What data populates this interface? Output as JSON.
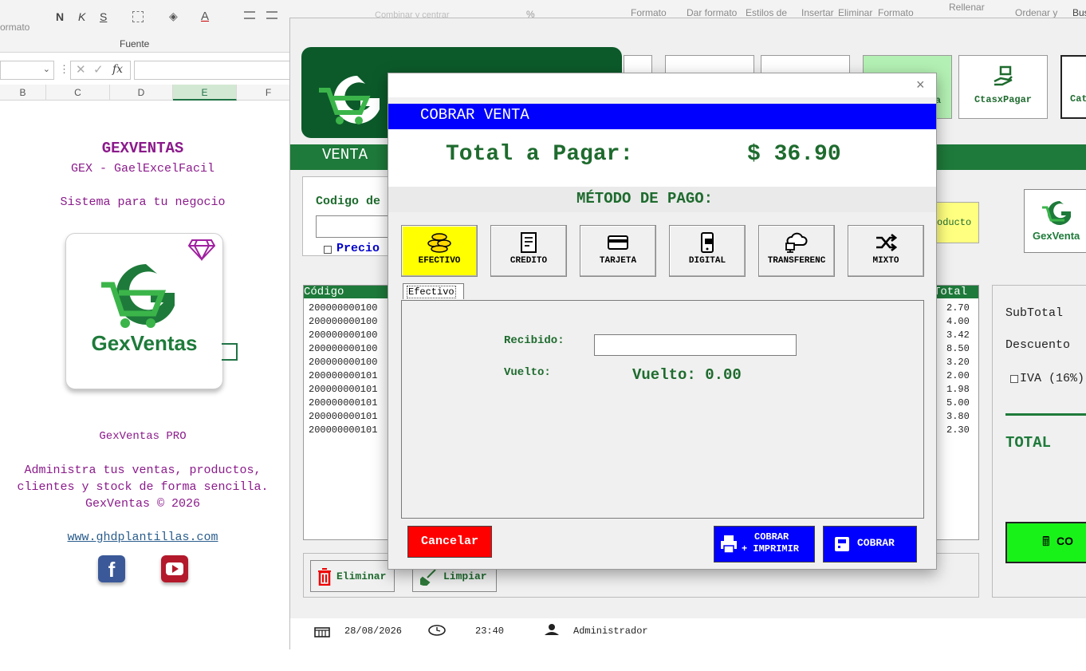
{
  "excel": {
    "ribbon": {
      "format_left": "ormato",
      "font_group": "Fuente",
      "bold": "N",
      "italic": "K",
      "underline": "S",
      "cmd_formato": "Formato",
      "cmd_dar_formato": "Dar formato",
      "cmd_estilos": "Estilos de",
      "cmd_insertar": "Insertar",
      "cmd_eliminar": "Eliminar",
      "cmd_formato2": "Formato",
      "cmd_rellenar": "Rellenar",
      "cmd_ordenar": "Ordenar y",
      "cmd_buscar": "Bus",
      "cmd_combinar": "Combinar y centrar",
      "percent": "%"
    },
    "formula_fx": "fx",
    "columns": [
      "B",
      "C",
      "D",
      "E",
      "F"
    ],
    "selected_column": "E",
    "sheet": {
      "title": "GEXVENTAS",
      "subtitle": "GEX - GaelExcelFacil",
      "tagline": "Sistema para tu negocio",
      "logo_text": "GexVentas",
      "pro_label": "GexVentas PRO",
      "desc1": "Administra tus ventas, productos,",
      "desc2": "clientes y stock de forma sencilla.",
      "copyright": "GexVentas © 2026",
      "website": "www.ghdplantillas.com"
    }
  },
  "app": {
    "toolbar": {
      "ctasxpagar": "CtasxPagar",
      "cat": "Cat",
      "partial_a": "a"
    },
    "venta_label": "VENTA",
    "codigo_label": "Codigo de",
    "precio_label": "Precio",
    "producto_btn": "oducto",
    "logo_small": "GexVenta",
    "table": {
      "header_codigo": "Código",
      "header_total": "Total",
      "codes": [
        "200000000100",
        "200000000100",
        "200000000100",
        "200000000100",
        "200000000100",
        "200000000101",
        "200000000101",
        "200000000101",
        "200000000101",
        "200000000101"
      ],
      "totals": [
        "2.70",
        "4.00",
        "3.42",
        "8.50",
        "3.20",
        "2.00",
        "1.98",
        "5.00",
        "3.80",
        "2.30"
      ]
    },
    "summary": {
      "subtotal": "SubTotal",
      "descuento": "Descuento",
      "iva": "IVA (16%)",
      "total": "TOTAL",
      "cobrar_partial": "CO"
    },
    "bottom": {
      "eliminar": "Eliminar",
      "limpiar": "Limpiar"
    },
    "status": {
      "date": "28/08/2026",
      "time": "23:40",
      "user": "Administrador"
    }
  },
  "modal": {
    "close": "×",
    "title": "COBRAR VENTA",
    "total_label": "Total a Pagar:",
    "total_value": "$ 36.90",
    "method_heading": "MÉTODO DE PAGO:",
    "methods": [
      "EFECTIVO",
      "CREDITO",
      "TARJETA",
      "DIGITAL",
      "TRANSFERENC",
      "MIXTO"
    ],
    "active_method": "EFECTIVO",
    "tab_label": "Efectivo",
    "recibido_label": "Recibido:",
    "recibido_value": "",
    "vuelto_label": "Vuelto:",
    "vuelto_display": "Vuelto: 0.00",
    "cancel_btn": "Cancelar",
    "cobrar_imprimir_line1": "COBRAR",
    "cobrar_imprimir_line2": "+ IMPRIMIR",
    "cobrar_btn": "COBRAR",
    "colors": {
      "title_bar": "#0000ff",
      "green_text": "#1e6b2e",
      "active_method": "#ffff00",
      "cancel": "#ff0000",
      "cobrar": "#0000ff"
    }
  }
}
